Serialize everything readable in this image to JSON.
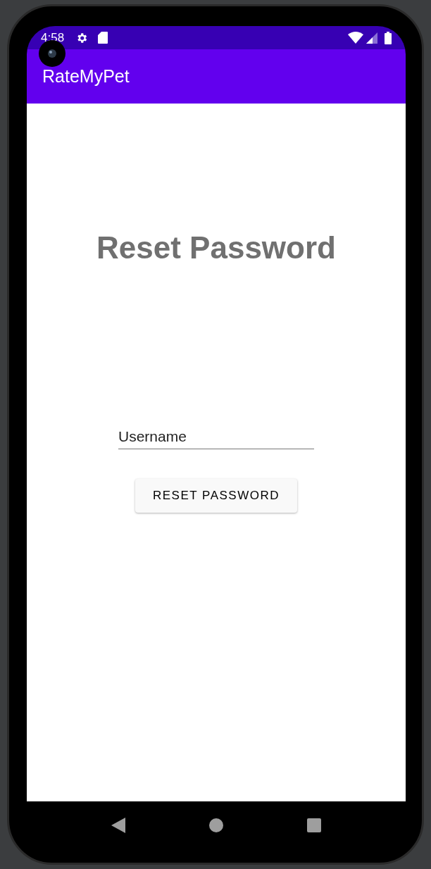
{
  "status_bar": {
    "time": "4:58"
  },
  "app_bar": {
    "title": "RateMyPet"
  },
  "heading": "Reset Password",
  "username_field": {
    "placeholder": "Username"
  },
  "button": {
    "label": "RESET PASSWORD"
  }
}
